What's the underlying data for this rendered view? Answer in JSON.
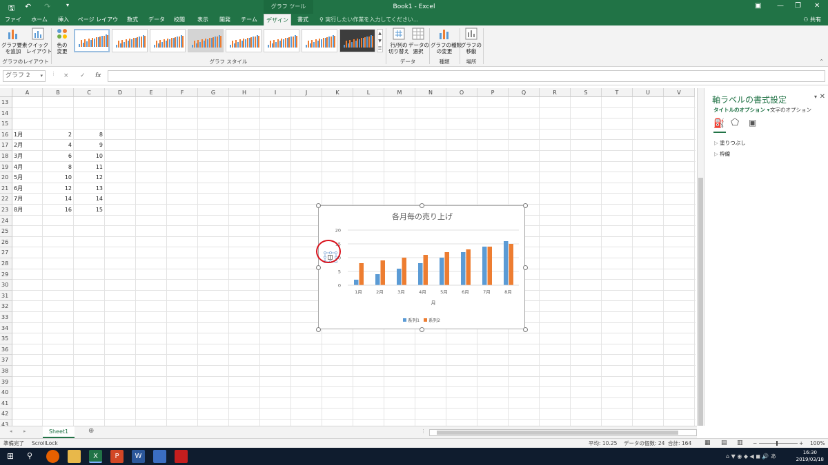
{
  "title_bar": {
    "doc_title": "Book1 - Excel",
    "context_tools": "グラフ ツール",
    "undo_icon": "undo-icon",
    "redo_icon": "redo-icon",
    "save_icon": "save-icon"
  },
  "tabs": [
    "ファイル",
    "ホーム",
    "挿入",
    "ページ レイアウト",
    "数式",
    "データ",
    "校閲",
    "表示",
    "開発",
    "チーム",
    "デザイン",
    "書式"
  ],
  "active_tab": "デザイン",
  "tellme": "実行したい作業を入力してください...",
  "share": "共有",
  "ribbon": {
    "add_element": "グラフ要素\nを追加",
    "quick_layout": "クイック\nレイアウト",
    "change_colors": "色の\n変更",
    "group_layout": "グラフのレイアウト",
    "group_styles": "グラフ スタイル",
    "switch_row_col": "行/列の\n切り替え",
    "select_data": "データの\n選択",
    "group_data": "データ",
    "change_type": "グラフの種類\nの変更",
    "group_type": "種類",
    "move_chart": "グラフの\n移動",
    "group_location": "場所"
  },
  "formula_bar": {
    "name_box": "グラフ 2",
    "cancel": "×",
    "enter": "✓",
    "fx": "fx",
    "content": ""
  },
  "columns": [
    "A",
    "B",
    "C",
    "D",
    "E",
    "F",
    "G",
    "H",
    "I",
    "J",
    "K",
    "L",
    "M",
    "N",
    "O",
    "P",
    "Q",
    "R",
    "S",
    "T",
    "U",
    "V"
  ],
  "rows": [
    "13",
    "14",
    "15",
    "16",
    "17",
    "18",
    "19",
    "20",
    "21",
    "22",
    "23",
    "24",
    "25",
    "26",
    "27",
    "28",
    "29",
    "30",
    "31",
    "32",
    "33",
    "34",
    "35",
    "36",
    "37",
    "38",
    "39",
    "40",
    "41",
    "42",
    "43"
  ],
  "table": [
    {
      "row": "16",
      "a": "1月",
      "b": "2",
      "c": "8"
    },
    {
      "row": "17",
      "a": "2月",
      "b": "4",
      "c": "9"
    },
    {
      "row": "18",
      "a": "3月",
      "b": "6",
      "c": "10"
    },
    {
      "row": "19",
      "a": "4月",
      "b": "8",
      "c": "11"
    },
    {
      "row": "20",
      "a": "5月",
      "b": "10",
      "c": "12"
    },
    {
      "row": "21",
      "a": "6月",
      "b": "12",
      "c": "13"
    },
    {
      "row": "22",
      "a": "7月",
      "b": "14",
      "c": "14"
    },
    {
      "row": "23",
      "a": "8月",
      "b": "16",
      "c": "15"
    }
  ],
  "chart_data": {
    "type": "bar",
    "title": "各月毎の売り上げ",
    "xlabel": "月",
    "ylabel": "",
    "categories": [
      "1月",
      "2月",
      "3月",
      "4月",
      "5月",
      "6月",
      "7月",
      "8月"
    ],
    "series": [
      {
        "name": "系列1",
        "values": [
          2,
          4,
          6,
          8,
          10,
          12,
          14,
          16
        ],
        "color": "#5b9bd5"
      },
      {
        "name": "系列2",
        "values": [
          8,
          9,
          10,
          11,
          12,
          13,
          14,
          15
        ],
        "color": "#ed7d31"
      }
    ],
    "ylim": [
      0,
      20
    ],
    "yticks": [
      "0",
      "5",
      "10",
      "15",
      "20"
    ],
    "grid": true,
    "legend": "bottom"
  },
  "side_pane": {
    "title": "軸ラベルの書式設定",
    "opt_title": "タイトルのオプション",
    "opt_text": "文字のオプション",
    "sections": [
      "塗りつぶし",
      "枠線"
    ]
  },
  "sheet_tab": "Sheet1",
  "status": {
    "ready": "準備完了",
    "scroll_lock": "ScrollLock",
    "average": "平均: 10.25",
    "count": "データの個数: 24",
    "sum": "合計: 164",
    "zoom": "100%"
  },
  "clock": {
    "time": "16:30",
    "date": "2019/03/18"
  }
}
